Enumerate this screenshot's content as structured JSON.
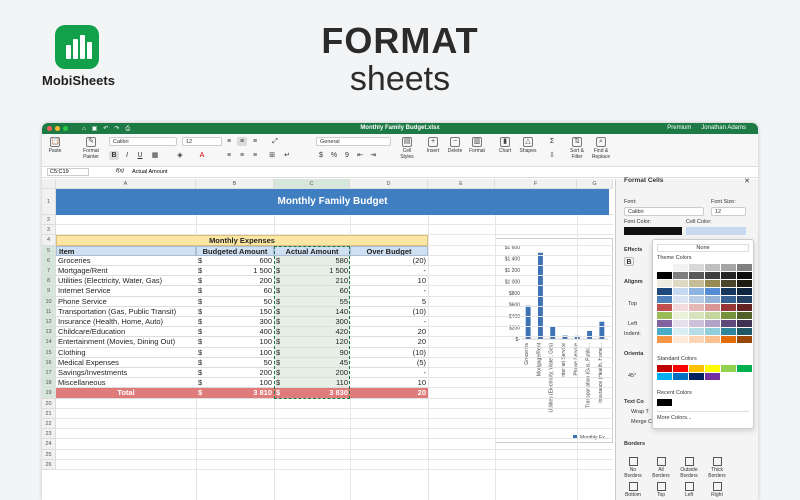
{
  "hero": {
    "title": "FORMAT",
    "subtitle": "sheets",
    "brand": "MobiSheets"
  },
  "window": {
    "title": "Monthly Family Budget.xlsx",
    "premium": "Premium",
    "user": "Jonathan Adams"
  },
  "ribbon": {
    "paste": "Paste",
    "format_painter": "Format Painter",
    "font": "Calibri",
    "font_size": "12",
    "bold": "B",
    "italic": "I",
    "underline": "U",
    "number_format": "General",
    "currency": "$",
    "percent": "%",
    "comma": "9",
    "cell_styles": "Cell Styles",
    "insert": "Insert",
    "delete": "Delete",
    "format": "Format",
    "chart": "Chart",
    "shapes": "Shapes",
    "sort_filter": "Sort & Filter",
    "find_replace": "Find & Replace"
  },
  "formula_bar": {
    "name_box": "C5:C19",
    "fx": "f(x)",
    "value": "Actual Amount"
  },
  "columns": [
    "A",
    "B",
    "C",
    "D",
    "E",
    "F",
    "G"
  ],
  "rows": [
    "1",
    "2",
    "3",
    "4",
    "5",
    "6",
    "7",
    "8",
    "9",
    "10",
    "11",
    "12",
    "13",
    "14",
    "15",
    "16",
    "17",
    "18",
    "19",
    "20",
    "21",
    "22",
    "23",
    "24",
    "25",
    "26"
  ],
  "sheet": {
    "title": "Monthly Family Budget",
    "section": "Monthly Expenses",
    "headers": [
      "Item",
      "Budgeted Amount",
      "Actual Amount",
      "Over Budget"
    ],
    "currency": "$",
    "items": [
      {
        "item": "Groceries",
        "budget": "600",
        "actual": "580",
        "over": "(20)"
      },
      {
        "item": "Mortgage/Rent",
        "budget": "1 500",
        "actual": "1 500",
        "over": "-"
      },
      {
        "item": "Utilities (Electricity, Water, Gas)",
        "budget": "200",
        "actual": "210",
        "over": "10"
      },
      {
        "item": "Internet Service",
        "budget": "60",
        "actual": "60",
        "over": "-"
      },
      {
        "item": "Phone Service",
        "budget": "50",
        "actual": "55",
        "over": "5"
      },
      {
        "item": "Transportation (Gas, Public Transit)",
        "budget": "150",
        "actual": "140",
        "over": "(10)"
      },
      {
        "item": "Insurance (Health, Home, Auto)",
        "budget": "300",
        "actual": "300",
        "over": "-"
      },
      {
        "item": "Childcare/Education",
        "budget": "400",
        "actual": "420",
        "over": "20"
      },
      {
        "item": "Entertainment (Movies, Dining Out)",
        "budget": "100",
        "actual": "120",
        "over": "20"
      },
      {
        "item": "Clothing",
        "budget": "100",
        "actual": "90",
        "over": "(10)"
      },
      {
        "item": "Medical Expenses",
        "budget": "50",
        "actual": "45",
        "over": "(5)"
      },
      {
        "item": "Savings/Investments",
        "budget": "200",
        "actual": "200",
        "over": "-"
      },
      {
        "item": "Miscellaneous",
        "budget": "100",
        "actual": "110",
        "over": "10"
      }
    ],
    "total": {
      "item": "Total",
      "budget": "3 810",
      "actual": "3 830",
      "over": "20"
    }
  },
  "chart_data": {
    "type": "bar",
    "categories": [
      "Groceries",
      "Mortgage/Rent",
      "Utilities (Electricity, Water, Gas)",
      "Internet Service",
      "Phone Service",
      "Transportation (Gas, Public...",
      "Insurance (Health, Home..."
    ],
    "series": [
      {
        "name": "Monthly Ex",
        "values": [
          580,
          1500,
          210,
          60,
          55,
          140,
          300
        ]
      }
    ],
    "yticks": [
      "$1 600",
      "$1 400",
      "$1 200",
      "$1 000",
      "$800",
      "$600",
      "$400",
      "$200",
      "$-"
    ],
    "ylim": [
      0,
      1600
    ],
    "color": "#3d73b5"
  },
  "panel": {
    "title": "Format Cells",
    "font_label": "Font:",
    "font_value": "Calibri",
    "font_size_label": "Font Size:",
    "font_size_value": "12",
    "font_color_label": "Font Color:",
    "cell_color_label": "Cell Color:",
    "effects_label": "Effects",
    "alignment_label": "Alignm",
    "top_label": "Top",
    "left_label": "Left",
    "indent_label": "Indent:",
    "orientation_label": "Orienta",
    "deg_label": "45°",
    "text_control_label": "Text Co",
    "wrap_label": "Wrap T",
    "merge_label": "Merge Cells",
    "borders_label": "Borders",
    "border_buttons": [
      "No Borders",
      "All Borders",
      "Outside Borders",
      "Thick Borders",
      "Bottom",
      "Top",
      "Left",
      "Right"
    ],
    "popup": {
      "none": "None",
      "theme_colors": "Theme Colors",
      "standard_colors": "Standard Colors",
      "recent_colors": "Recent Colors",
      "more_colors": "More Colors..."
    },
    "theme_swatches": [
      [
        "#ffffff",
        "#f2f2f2",
        "#d9d9d9",
        "#bfbfbf",
        "#a6a6a6",
        "#808080"
      ],
      [
        "#000000",
        "#7f7f7f",
        "#595959",
        "#404040",
        "#262626",
        "#0d0d0d"
      ],
      [
        "#eeece1",
        "#ddd9c3",
        "#c4bd97",
        "#948a54",
        "#4a452a",
        "#1e1c11"
      ],
      [
        "#1f497d",
        "#c6d9f0",
        "#8db3e2",
        "#548dd4",
        "#17365d",
        "#0f243e"
      ],
      [
        "#4f81bd",
        "#dbe5f1",
        "#b8cce4",
        "#95b3d7",
        "#366092",
        "#244061"
      ],
      [
        "#c0504d",
        "#f2dcdb",
        "#e5b9b7",
        "#d99694",
        "#953734",
        "#632423"
      ],
      [
        "#9bbb59",
        "#ebf1dd",
        "#d7e3bc",
        "#c3d69b",
        "#76923c",
        "#4f6128"
      ],
      [
        "#8064a2",
        "#e5e0ec",
        "#ccc1d9",
        "#b2a2c7",
        "#5f497a",
        "#3f3151"
      ],
      [
        "#4bacc6",
        "#dbeef3",
        "#b7dde8",
        "#92cddc",
        "#31859b",
        "#205867"
      ],
      [
        "#f79646",
        "#fdeada",
        "#fbd5b5",
        "#fac08f",
        "#e36c09",
        "#974806"
      ]
    ],
    "standard_swatches": [
      "#c00000",
      "#ff0000",
      "#ffc000",
      "#ffff00",
      "#92d050",
      "#00b050",
      "#00b0f0",
      "#0070c0",
      "#002060",
      "#7030a0"
    ]
  }
}
